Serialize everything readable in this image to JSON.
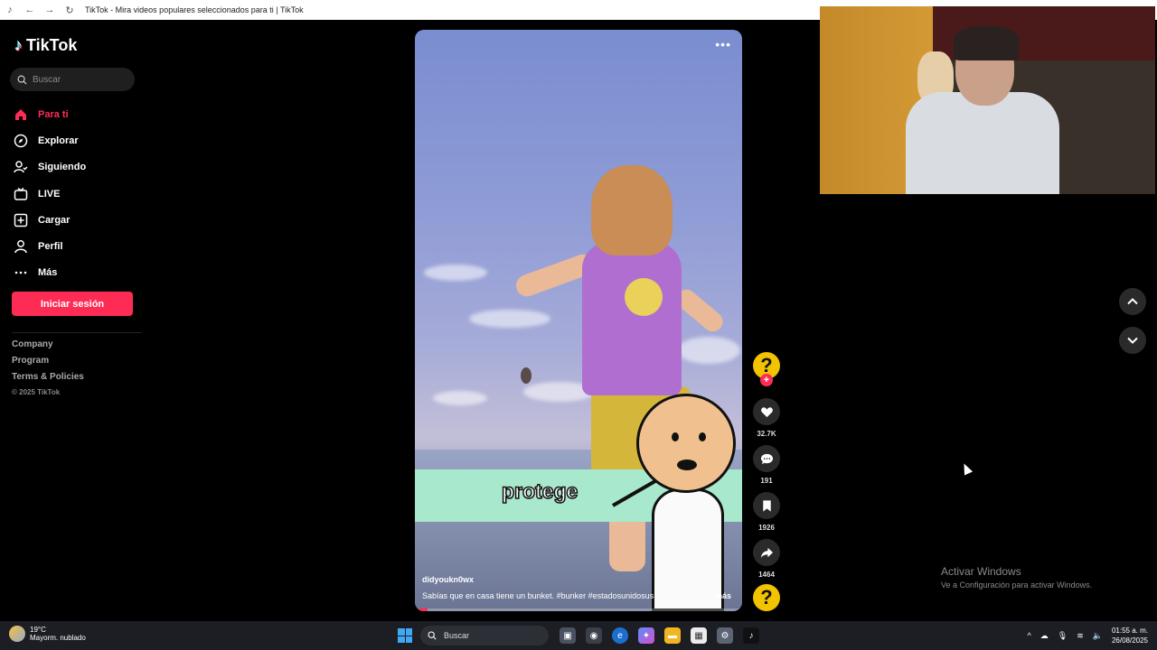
{
  "browser": {
    "title": "TikTok - Mira videos populares seleccionados para ti | TikTok"
  },
  "sidebar": {
    "logo_text": "TikTok",
    "search_placeholder": "Buscar",
    "nav": [
      {
        "label": "Para ti",
        "icon": "home-icon",
        "active": true
      },
      {
        "label": "Explorar",
        "icon": "compass-icon"
      },
      {
        "label": "Siguiendo",
        "icon": "following-icon"
      },
      {
        "label": "LIVE",
        "icon": "live-icon"
      },
      {
        "label": "Cargar",
        "icon": "upload-icon"
      },
      {
        "label": "Perfil",
        "icon": "profile-icon"
      },
      {
        "label": "Más",
        "icon": "more-icon"
      }
    ],
    "login_label": "Iniciar sesión",
    "links": [
      "Company",
      "Program",
      "Terms & Policies"
    ],
    "copyright": "© 2025 TikTok"
  },
  "video": {
    "caption_word": "protege",
    "username": "didyoukn0wx",
    "description": "Sabías que en casa tiene un bunket. #bunker  #estadosunidosus  ...",
    "more_label": "más",
    "progress": 0.04
  },
  "actions": {
    "likes": "32.7K",
    "comments": "191",
    "saves": "1926",
    "shares": "1464"
  },
  "watermark": {
    "title": "Activar Windows",
    "subtitle": "Ve a Configuración para activar Windows."
  },
  "taskbar": {
    "temperature": "19°C",
    "weather": "Mayorm. nublado",
    "search_label": "Buscar",
    "time": "01:55 a. m.",
    "date": "26/08/2025"
  },
  "colors": {
    "accent": "#fe2c55",
    "background": "#000000"
  }
}
